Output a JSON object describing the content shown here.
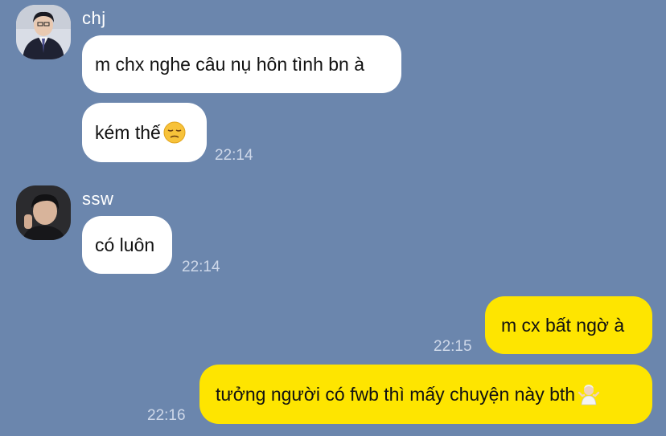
{
  "chat": {
    "colors": {
      "background": "#6b86ad",
      "incoming_bubble": "#ffffff",
      "outgoing_bubble": "#fee500"
    },
    "messages": [
      {
        "sender": "chj",
        "avatar": "avatar-chj",
        "text": "m chx nghe câu nụ hôn tình bn à",
        "time": ""
      },
      {
        "sender": "chj",
        "text": "kém thế",
        "emoji": "pensive-face-icon",
        "time": "22:14"
      },
      {
        "sender": "ssw",
        "avatar": "avatar-ssw",
        "text": "có luôn",
        "time": "22:14"
      },
      {
        "sender": "me",
        "text": "m cx bất ngờ à",
        "time": "22:15"
      },
      {
        "sender": "me",
        "text": "tưởng người có fwb thì mấy chuyện này bth",
        "emoji": "person-shrugging-icon",
        "time": "22:16"
      }
    ]
  }
}
